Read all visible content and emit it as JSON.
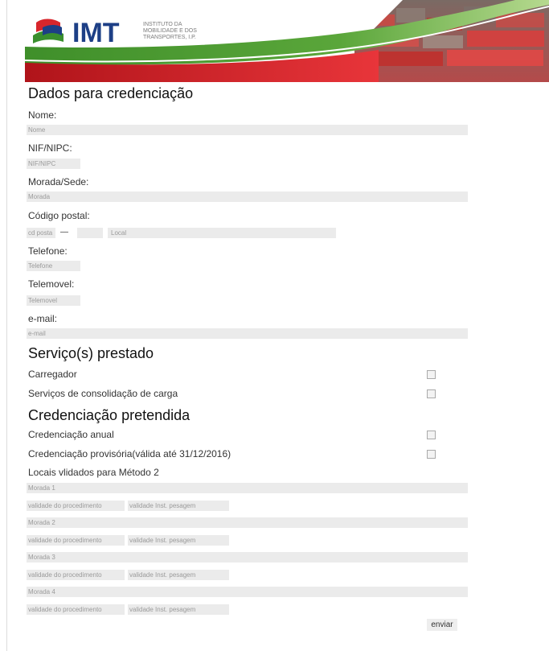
{
  "header": {
    "logo_text": "IMT",
    "logo_subtitle_lines": [
      "INSTITUTO DA",
      "MOBILIDADE E DOS",
      "TRANSPORTES, I.P."
    ]
  },
  "section_dados": {
    "title": "Dados para credenciação",
    "nome_label": "Nome:",
    "nome_placeholder": "Nome",
    "nif_label": "NIF/NIPC:",
    "nif_placeholder": "NIF/NIPC",
    "morada_label": "Morada/Sede:",
    "morada_placeholder": "Morada",
    "codigo_postal_label": "Código postal:",
    "cp_placeholder": "cd posta",
    "cp_separator": "—",
    "local_placeholder": "Local",
    "telefone_label": "Telefone:",
    "telefone_placeholder": "Telefone",
    "telemovel_label": "Telemovel:",
    "telemovel_placeholder": "Telemovel",
    "email_label": "e-mail:",
    "email_placeholder": "e-mail"
  },
  "section_servicos": {
    "title": "Serviço(s) prestado",
    "items": [
      "Carregador",
      "Serviços de consolidação de carga"
    ]
  },
  "section_credenciacao": {
    "title": "Credenciação pretendida",
    "items": [
      "Credenciação anual",
      "Credenciação provisória(válida até 31/12/2016)"
    ],
    "locais_label": "Locais vlidados para Método 2",
    "morada_placeholders": [
      "Morada 1",
      "Morada 2",
      "Morada 3",
      "Morada 4"
    ],
    "validade_procedimento_placeholder": "validade do procedimento",
    "validade_pesagem_placeholder": "validade Inst. pesagem"
  },
  "submit_label": "enviar",
  "colors": {
    "logo_blue": "#1d3f86",
    "banner_green": "#4e9a2a",
    "banner_red": "#d8262c",
    "input_bg": "#ebebeb"
  }
}
